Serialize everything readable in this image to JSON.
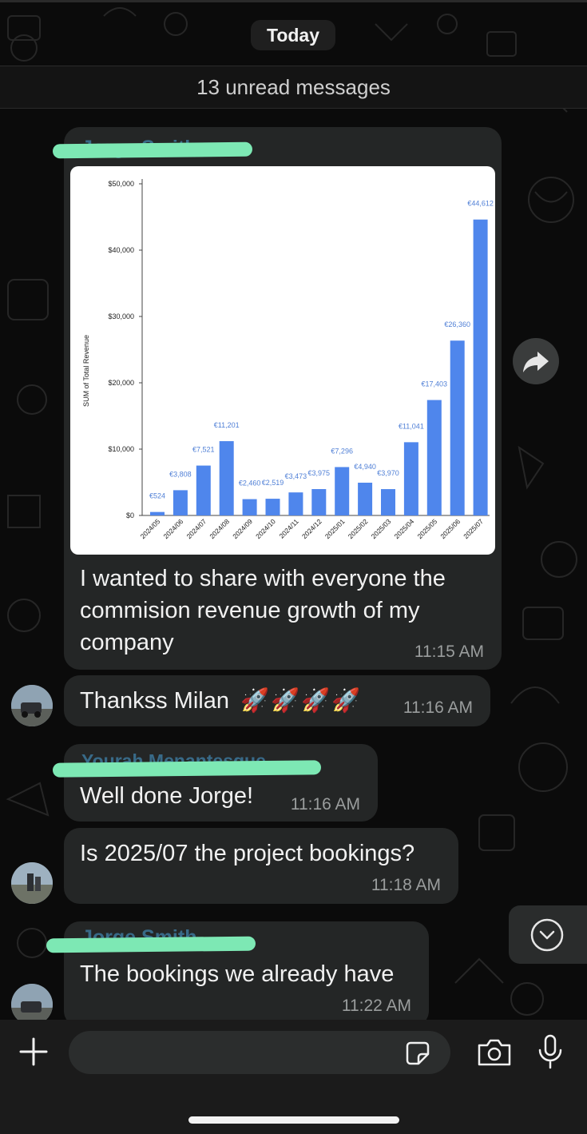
{
  "day_label": "Today",
  "unread_label": "13 unread messages",
  "messages": [
    {
      "sender": "Jorge Smith",
      "text_lines": [
        "I wanted to share with everyone the",
        "commision revenue growth of my",
        "company"
      ],
      "time": "11:15 AM"
    },
    {
      "text": "Thankss Milan",
      "emoji": "🚀🚀🚀🚀",
      "time": "11:16 AM"
    },
    {
      "sender": "Yourah Menantesque",
      "text": "Well done Jorge!",
      "time": "11:16 AM"
    },
    {
      "text": "Is 2025/07 the project bookings?",
      "time": "11:18 AM"
    },
    {
      "sender": "Jorge Smith",
      "text": "The bookings we already have",
      "time": "11:22 AM"
    }
  ],
  "chart_data": {
    "type": "bar",
    "ylabel": "SUM of Total Revenue",
    "ylim": [
      0,
      50000
    ],
    "yticks": [
      "$0",
      "$10,000",
      "$20,000",
      "$30,000",
      "$40,000",
      "$50,000"
    ],
    "categories": [
      "2024/05",
      "2024/06",
      "2024/07",
      "2024/08",
      "2024/09",
      "2024/10",
      "2024/11",
      "2024/12",
      "2025/01",
      "2025/02",
      "2025/03",
      "2025/04",
      "2025/05",
      "2025/06",
      "2025/07"
    ],
    "values": [
      524,
      3808,
      7521,
      11201,
      2460,
      2519,
      3473,
      3975,
      7296,
      4940,
      3970,
      11041,
      17403,
      26360,
      44612
    ],
    "labels": [
      "€524",
      "€3,808",
      "€7,521",
      "€11,201",
      "€2,460",
      "€2,519",
      "€3,473",
      "€3,975",
      "€7,296",
      "€4,940",
      "€3,970",
      "€11,041",
      "€17,403",
      "€26,360",
      "€44,612"
    ],
    "bar_color": "#4f86ec",
    "label_color": "#4f7fd6"
  },
  "icons": {
    "forward": "forward-arrow-icon",
    "scroll": "chevron-down-icon",
    "add": "plus-icon",
    "sticker": "sticker-icon",
    "camera": "camera-icon",
    "mic": "microphone-icon"
  },
  "colors": {
    "bubble": "#242626",
    "background": "#0b0b0b",
    "redaction": "#7de8b4"
  }
}
